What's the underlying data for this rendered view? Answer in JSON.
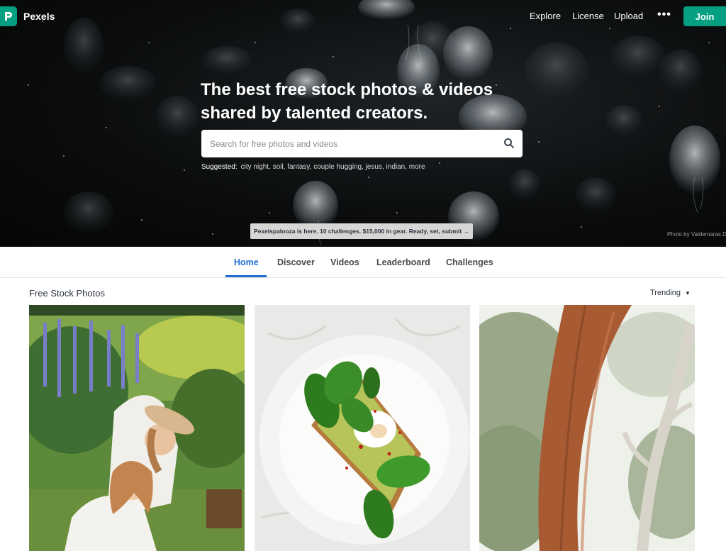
{
  "nav": {
    "brand": "Pexels",
    "links": [
      "Explore",
      "License",
      "Upload"
    ],
    "more": "•••",
    "join_label": "Join"
  },
  "hero": {
    "headline_line1": "The best free stock photos & videos",
    "headline_line2": "shared by talented creators.",
    "search_placeholder": "Search for free photos and videos",
    "suggested_label": "Suggested:",
    "suggestions": "city night, soil, fantasy, couple hugging, jesus, indian, more",
    "banner": "Pexelspalooza is here. 10 challenges. $15,000 in gear. Ready, set, submit →",
    "photo_credit": "Photo by Valdemaras D"
  },
  "tabs": [
    "Home",
    "Discover",
    "Videos",
    "Leaderboard",
    "Challenges"
  ],
  "active_tab": "Home",
  "section": {
    "title": "Free Stock Photos",
    "sort_label": "Trending"
  },
  "photos": [
    {
      "icon": "photo-women-garden"
    },
    {
      "icon": "photo-avocado-toast"
    },
    {
      "icon": "photo-trees"
    }
  ],
  "colors": {
    "brand_green": "#05a081",
    "active_tab_blue": "#1f6fd6",
    "text_dark": "#2c343e"
  }
}
